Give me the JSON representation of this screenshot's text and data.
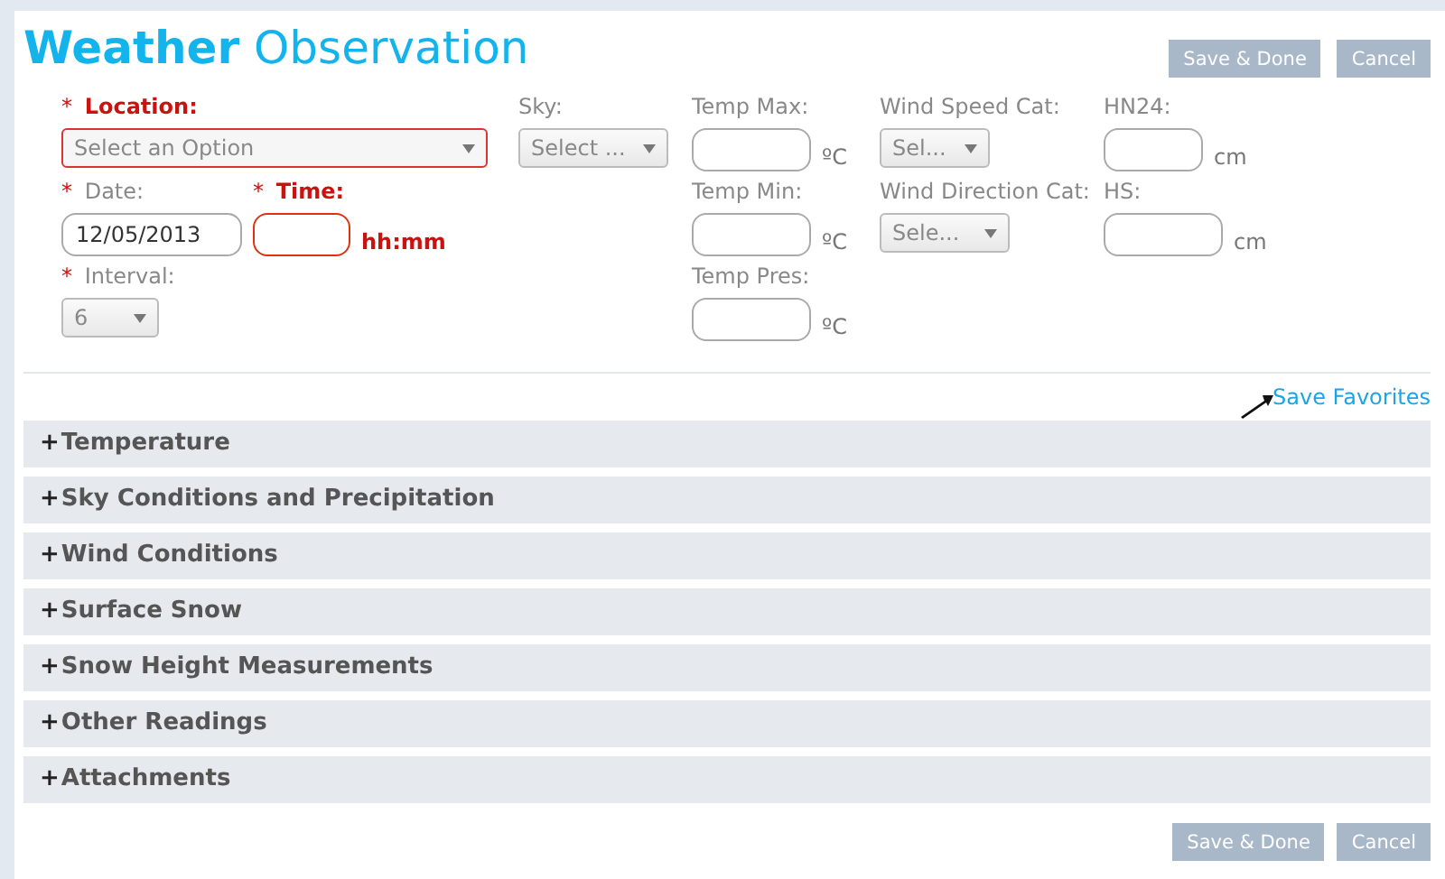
{
  "title": "**Weather** Observation",
  "top_buttons": [
    {
      "label": "Save & Done",
      "disabled": true
    },
    {
      "label": "Cancel",
      "disabled": true
    }
  ],
  "columns": [
    {
      "rows": [
        [
          {
            "marker": "*",
            "label": "Location:",
            "invalid": true,
            "kind": "select",
            "value": "Select an Option"
          }
        ],
        [
          {
            "marker": "*",
            "label": "Date:",
            "invalid": false,
            "kind": "text",
            "value": "12/05/2013"
          },
          {
            "marker": "*",
            "label": "Time:",
            "invalid": true,
            "kind": "text",
            "unit": "hh:mm"
          }
        ],
        [
          {
            "marker": "*",
            "label": "Interval:",
            "invalid": false,
            "kind": "select",
            "value": "6"
          }
        ]
      ]
    },
    {
      "rows": [
        [
          {
            "label": "Sky:",
            "invalid": false,
            "kind": "select",
            "value": "Select ..."
          }
        ]
      ]
    },
    {
      "rows": [
        [
          {
            "label": "Temp Max:",
            "invalid": false,
            "kind": "text",
            "unit": "ºC"
          }
        ],
        [
          {
            "label": "Temp Min:",
            "invalid": false,
            "kind": "text",
            "unit": "ºC"
          }
        ],
        [
          {
            "label": "Temp Pres:",
            "invalid": false,
            "kind": "text",
            "unit": "ºC"
          }
        ]
      ]
    },
    {
      "rows": [
        [
          {
            "label": "Wind Speed Cat:",
            "invalid": false,
            "kind": "select",
            "value": "Sel..."
          }
        ],
        [
          {
            "label": "Wind Direction Cat:",
            "invalid": false,
            "kind": "select",
            "value": "Sele..."
          }
        ]
      ]
    },
    {
      "rows": [
        [
          {
            "label": "HN24:",
            "invalid": false,
            "kind": "text",
            "unit": "cm"
          }
        ],
        [
          {
            "label": "HS:",
            "invalid": false,
            "kind": "text",
            "unit": "cm"
          }
        ]
      ]
    }
  ],
  "favorites_link": "Save Favorites",
  "sections": [
    {
      "toggle": "+",
      "title": "Temperature"
    },
    {
      "toggle": "+",
      "title": "Sky Conditions and Precipitation"
    },
    {
      "toggle": "+",
      "title": "Wind Conditions"
    },
    {
      "toggle": "+",
      "title": "Surface Snow"
    },
    {
      "toggle": "+",
      "title": "Snow Height Measurements"
    },
    {
      "toggle": "+",
      "title": "Other Readings"
    },
    {
      "toggle": "+",
      "title": "Attachments"
    }
  ],
  "bottom_buttons": [
    {
      "label": "Save & Done",
      "disabled": true
    },
    {
      "label": "Cancel",
      "disabled": true
    }
  ]
}
